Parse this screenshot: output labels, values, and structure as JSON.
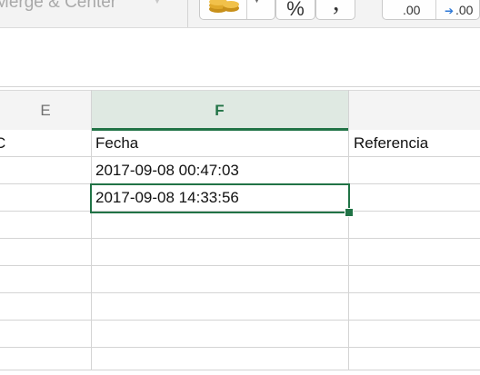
{
  "toolbar": {
    "merge_label": "Merge & Center",
    "merge_dropdown_icon": "chevron-down-icon",
    "currency_icon": "coins-icon",
    "currency_dropdown_icon": "caret-down-icon",
    "percent_label": "%",
    "comma_label": ",",
    "decrease_decimal_label": ".00",
    "increase_decimal_icon": "arrow-right-icon",
    "increase_decimal_label": ".00"
  },
  "columns": [
    {
      "id": "E",
      "label": "E"
    },
    {
      "id": "F",
      "label": "F",
      "selected": true
    },
    {
      "id": "G",
      "label": ""
    }
  ],
  "rows": [
    {
      "e": "C",
      "f": "Fecha",
      "g": "Referencia"
    },
    {
      "e": "",
      "f": "2017-09-08 00:47:03",
      "g": ""
    },
    {
      "e": "",
      "f": "2017-09-08 14:33:56",
      "g": ""
    },
    {
      "e": "",
      "f": "",
      "g": ""
    },
    {
      "e": "",
      "f": "",
      "g": ""
    },
    {
      "e": "",
      "f": "",
      "g": ""
    },
    {
      "e": "",
      "f": "",
      "g": ""
    },
    {
      "e": "",
      "f": "",
      "g": ""
    },
    {
      "e": "",
      "f": "",
      "g": ""
    }
  ],
  "colors": {
    "accent": "#217346",
    "gridline": "#d4d4d4",
    "header_bg": "#f4f4f4",
    "increase_arrow": "#2d78d6"
  }
}
